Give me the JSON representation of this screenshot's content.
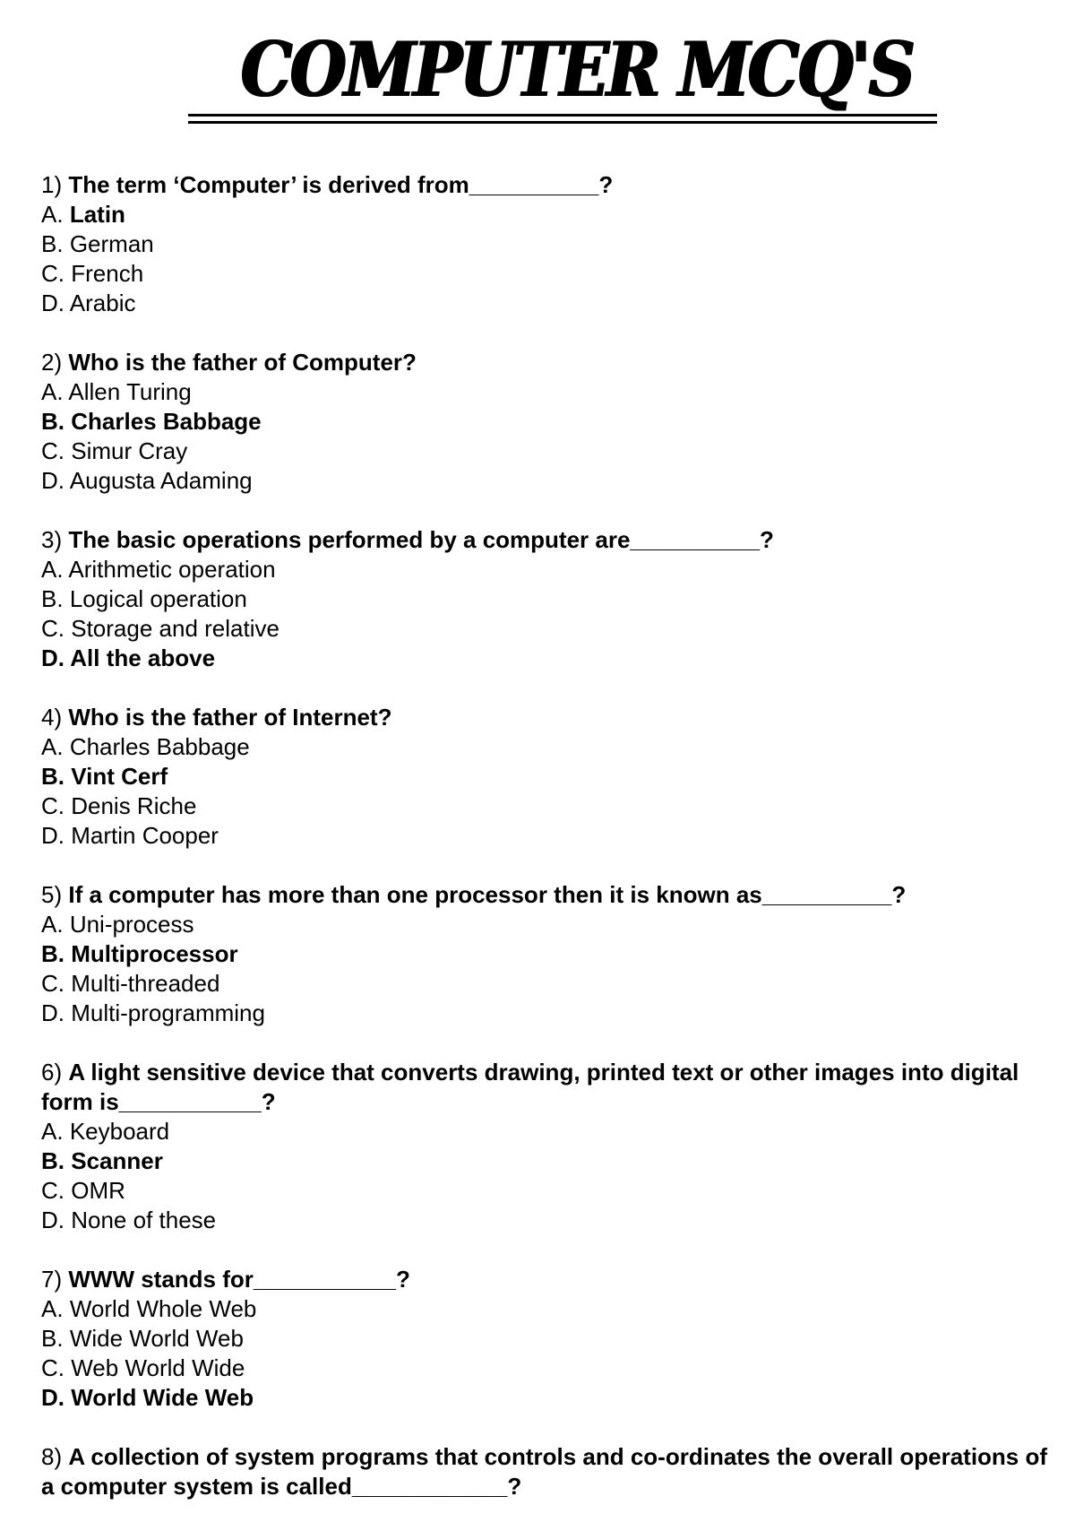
{
  "title": "COMPUTER MCQ'S",
  "questions": [
    {
      "number": "1)",
      "text": "The term ‘Computer’ is derived from__________?",
      "options": [
        {
          "letter": "A.",
          "text": "Latin",
          "correct": true,
          "style": "value-bold"
        },
        {
          "letter": "B.",
          "text": "German",
          "correct": false
        },
        {
          "letter": "C.",
          "text": "French",
          "correct": false
        },
        {
          "letter": "D.",
          "text": "Arabic",
          "correct": false
        }
      ]
    },
    {
      "number": "2)",
      "text": "Who is the father of Computer?",
      "options": [
        {
          "letter": "A.",
          "text": "Allen Turing",
          "correct": false
        },
        {
          "letter": "B.",
          "text": "Charles Babbage",
          "correct": true
        },
        {
          "letter": "C.",
          "text": "Simur Cray",
          "correct": false
        },
        {
          "letter": "D.",
          "text": "Augusta Adaming",
          "correct": false
        }
      ]
    },
    {
      "number": "3)",
      "text": "The basic operations performed by a computer are__________?",
      "options": [
        {
          "letter": "A.",
          "text": "Arithmetic operation",
          "correct": false
        },
        {
          "letter": "B.",
          "text": "Logical operation",
          "correct": false
        },
        {
          "letter": "C.",
          "text": "Storage and relative",
          "correct": false
        },
        {
          "letter": "D.",
          "text": "All the above",
          "correct": true
        }
      ]
    },
    {
      "number": "4)",
      "text": "Who is the father of Internet?",
      "options": [
        {
          "letter": "A.",
          "text": "Charles Babbage",
          "correct": false
        },
        {
          "letter": "B.",
          "text": "Vint Cerf",
          "correct": true
        },
        {
          "letter": "C.",
          "text": "Denis Riche",
          "correct": false
        },
        {
          "letter": "D.",
          "text": "Martin Cooper",
          "correct": false
        }
      ]
    },
    {
      "number": "5)",
      "text": "If a computer has more than one processor then it is known as__________?",
      "options": [
        {
          "letter": "A.",
          "text": "Uni-process",
          "correct": false
        },
        {
          "letter": "B.",
          "text": "Multiprocessor",
          "correct": true
        },
        {
          "letter": "C.",
          "text": "Multi-threaded",
          "correct": false
        },
        {
          "letter": "D.",
          "text": "Multi-programming",
          "correct": false
        }
      ]
    },
    {
      "number": "6)",
      "text": "A light sensitive device that converts drawing, printed text or other images into digital form is___________?",
      "options": [
        {
          "letter": "A.",
          "text": "Keyboard",
          "correct": false
        },
        {
          "letter": "B.",
          "text": "Scanner",
          "correct": true
        },
        {
          "letter": "C.",
          "text": "OMR",
          "correct": false
        },
        {
          "letter": "D.",
          "text": "None of these",
          "correct": false
        }
      ]
    },
    {
      "number": "7)",
      "text": "WWW stands for___________?",
      "options": [
        {
          "letter": "A.",
          "text": "World Whole Web",
          "correct": false
        },
        {
          "letter": "B.",
          "text": "Wide World Web",
          "correct": false
        },
        {
          "letter": "C.",
          "text": "Web World Wide",
          "correct": false
        },
        {
          "letter": "D.",
          "text": "World Wide Web",
          "correct": true
        }
      ]
    },
    {
      "number": "8)",
      "text": "A collection of system programs that controls and co-ordinates the overall operations of a computer system is called____________?",
      "options": []
    }
  ]
}
